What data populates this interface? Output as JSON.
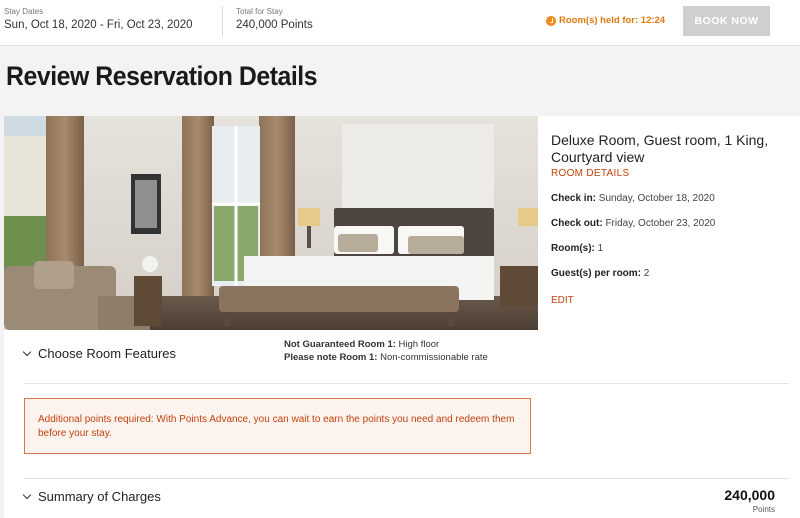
{
  "header": {
    "stay_label": "Stay Dates",
    "stay_value": "Sun, Oct 18, 2020 - Fri, Oct 23, 2020",
    "total_label": "Total for Stay",
    "total_value": "240,000 Points",
    "held_text": "Room(s) held for: 12:24",
    "book_label": "BOOK NOW",
    "accent_color": "#e07a10"
  },
  "page": {
    "title": "Review Reservation Details"
  },
  "room": {
    "name": "Deluxe Room, Guest room, 1 King, Courtyard view",
    "details_link": "ROOM DETAILS",
    "check_in_label": "Check in:",
    "check_in_value": "Sunday, October 18, 2020",
    "check_out_label": "Check out:",
    "check_out_value": "Friday, October 23, 2020",
    "rooms_label": "Room(s):",
    "rooms_value": "1",
    "guests_label": "Guest(s) per room:",
    "guests_value": "2",
    "edit_link": "EDIT"
  },
  "features": {
    "heading": "Choose Room Features",
    "note1_label": "Not Guaranteed Room 1:",
    "note1_value": "High floor",
    "note2_label": "Please note Room 1:",
    "note2_value": "Non-commissionable rate"
  },
  "alert": {
    "text": "Additional points required: With Points Advance, you can wait to earn the points you need and redeem them before your stay."
  },
  "summary": {
    "heading": "Summary of Charges",
    "total": "240,000",
    "unit": "Points"
  }
}
